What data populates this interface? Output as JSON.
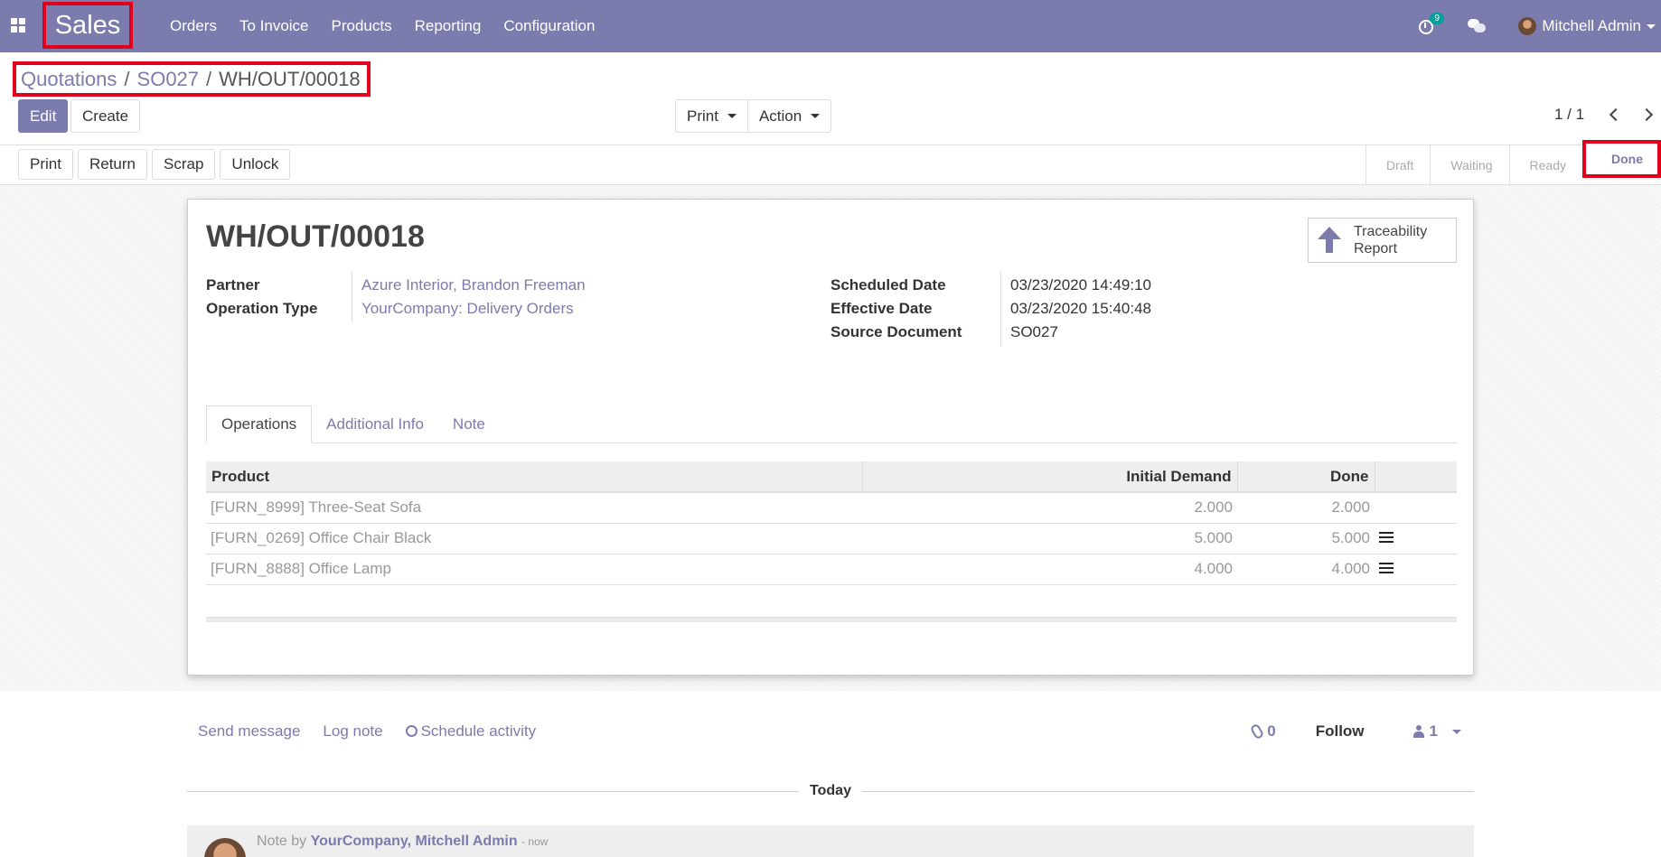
{
  "app": {
    "name": "Sales",
    "menu": [
      "Orders",
      "To Invoice",
      "Products",
      "Reporting",
      "Configuration"
    ],
    "activity_count": "9",
    "user": "Mitchell Admin"
  },
  "breadcrumb": {
    "root": "Quotations",
    "parent": "SO027",
    "current": "WH/OUT/00018"
  },
  "toolbar": {
    "edit": "Edit",
    "create": "Create",
    "print": "Print",
    "action": "Action",
    "pager": "1 / 1"
  },
  "status_buttons": {
    "print": "Print",
    "return": "Return",
    "scrap": "Scrap",
    "unlock": "Unlock"
  },
  "stages": [
    "Draft",
    "Waiting",
    "Ready",
    "Done"
  ],
  "form": {
    "title": "WH/OUT/00018",
    "smart_button": "Traceability Report",
    "partner_label": "Partner",
    "partner": "Azure Interior, Brandon Freeman",
    "operation_type_label": "Operation Type",
    "operation_type": "YourCompany: Delivery Orders",
    "scheduled_date_label": "Scheduled Date",
    "scheduled_date": "03/23/2020 14:49:10",
    "effective_date_label": "Effective Date",
    "effective_date": "03/23/2020 15:40:48",
    "source_document_label": "Source Document",
    "source_document": "SO027"
  },
  "tabs": [
    "Operations",
    "Additional Info",
    "Note"
  ],
  "operations": {
    "headers": [
      "Product",
      "Initial Demand",
      "Done"
    ],
    "rows": [
      {
        "product": "[FURN_8999] Three-Seat Sofa",
        "demand": "2.000",
        "done": "2.000"
      },
      {
        "product": "[FURN_0269] Office Chair Black",
        "demand": "5.000",
        "done": "5.000"
      },
      {
        "product": "[FURN_8888] Office Lamp",
        "demand": "4.000",
        "done": "4.000"
      }
    ]
  },
  "chatter": {
    "send_message": "Send message",
    "log_note": "Log note",
    "schedule_activity": "Schedule activity",
    "attachments": "0",
    "follow": "Follow",
    "followers": "1",
    "separator": "Today",
    "message_prefix": "Note by",
    "message_author": "YourCompany, Mitchell Admin",
    "message_time": "- now"
  }
}
